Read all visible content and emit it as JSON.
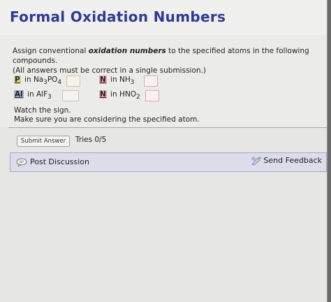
{
  "header": {
    "title": "Formal Oxidation Numbers"
  },
  "problem": {
    "prompt_pre": "Assign conventional ",
    "prompt_em": "oxidation numbers",
    "prompt_post": " to the specified atoms in the following compounds.",
    "prompt_note": "(All answers must be correct in a single submission.)",
    "items": [
      {
        "atom": "P",
        "connector": " in ",
        "compound": "Na",
        "sub1": "3",
        "compound2": "PO",
        "sub2": "4",
        "answer": ""
      },
      {
        "atom": "N",
        "connector": " in ",
        "compound": "NH",
        "sub1": "3",
        "compound2": "",
        "sub2": "",
        "answer": ""
      },
      {
        "atom": "Al",
        "connector": " in ",
        "compound": "AlF",
        "sub1": "3",
        "compound2": "",
        "sub2": "",
        "answer": ""
      },
      {
        "atom": "N",
        "connector": " in ",
        "compound": "HNO",
        "sub1": "2",
        "compound2": "",
        "sub2": "",
        "answer": ""
      }
    ],
    "hint1": "Watch the sign.",
    "hint2": "Make sure you are considering the specified atom."
  },
  "actions": {
    "submit_label": "Submit Answer",
    "tries": "Tries 0/5"
  },
  "discussion": {
    "post_label": "Post Discussion",
    "feedback_label": "Send Feedback"
  },
  "colors": {
    "title": "#2f3a96",
    "highlight_p": "#d9cf86",
    "highlight_al": "#9fb0cf",
    "highlight_n": "#e8a6a6",
    "discussion_bar": "#dcdcea"
  }
}
